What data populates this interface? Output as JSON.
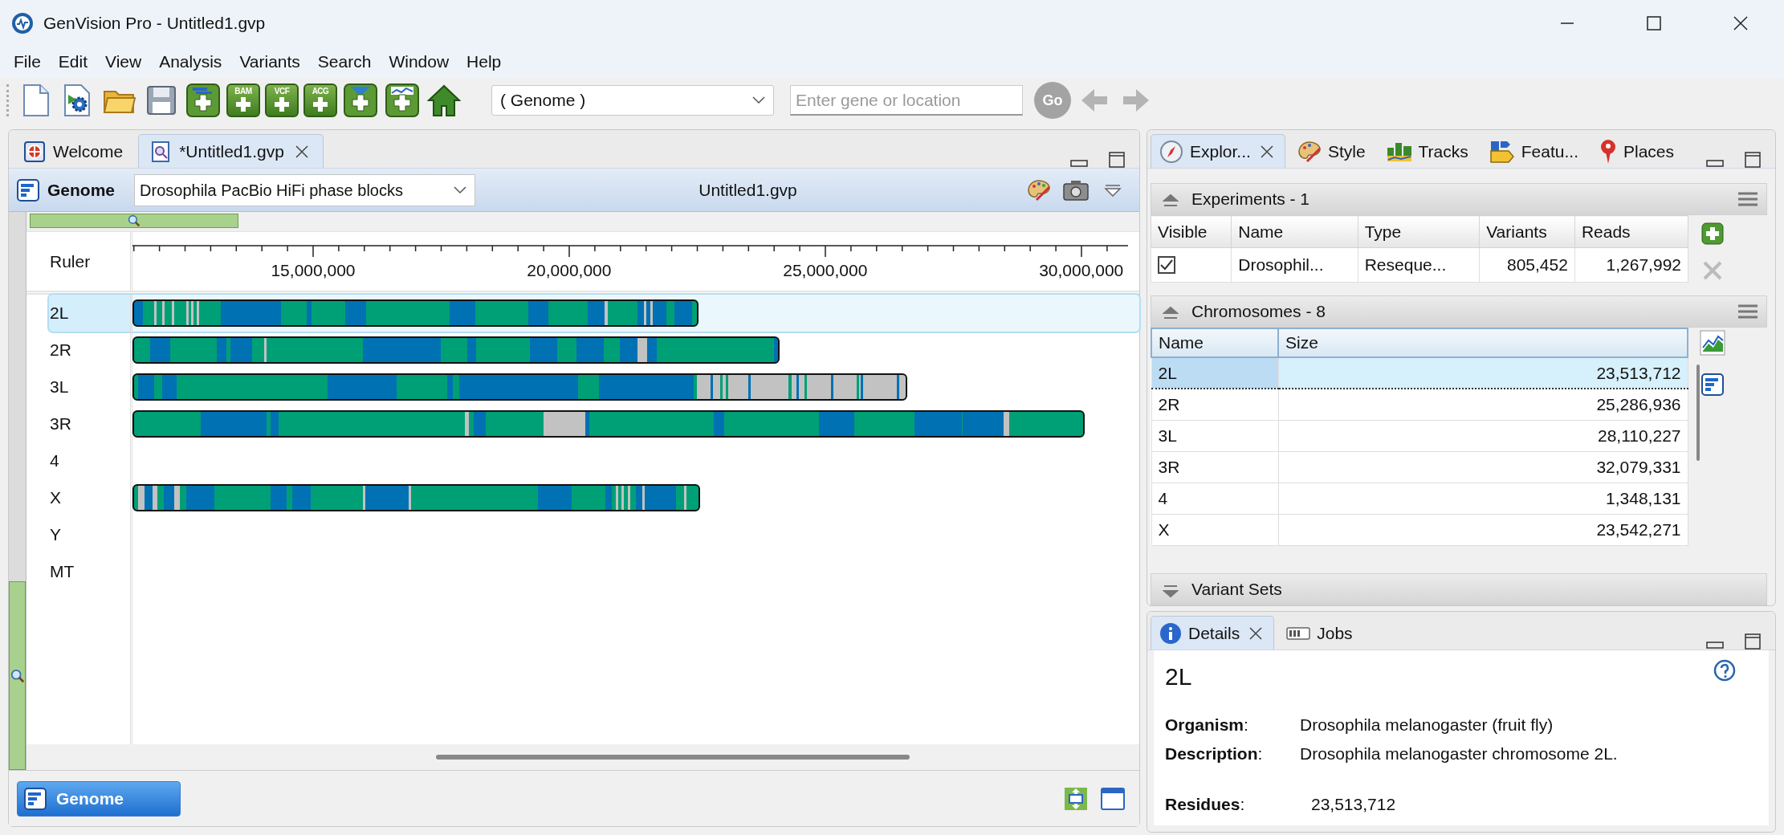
{
  "window": {
    "title": "GenVision Pro - Untitled1.gvp"
  },
  "menu": [
    "File",
    "Edit",
    "View",
    "Analysis",
    "Variants",
    "Search",
    "Window",
    "Help"
  ],
  "toolbar": [
    {
      "kind": "new-document"
    },
    {
      "kind": "document-settings"
    },
    {
      "kind": "folder"
    },
    {
      "kind": "save"
    },
    {
      "kind": "add-tracks"
    },
    {
      "kind": "add-labeled",
      "label": "BAM"
    },
    {
      "kind": "add-labeled",
      "label": "VCF"
    },
    {
      "kind": "add-labeled",
      "label": "ACG"
    },
    {
      "kind": "add-filter"
    },
    {
      "kind": "add-chart"
    },
    {
      "kind": "home"
    }
  ],
  "genome_select": {
    "value": "( Genome )"
  },
  "location_field": {
    "placeholder": "Enter gene or location"
  },
  "go_button": {
    "label": "Go",
    "disabled": true
  },
  "navigation": [
    {
      "kind": "back",
      "disabled": true
    },
    {
      "kind": "forward",
      "disabled": true
    }
  ],
  "editor_tabs": [
    {
      "kind": "welcome",
      "label": "Welcome",
      "selected": false,
      "closable": false
    },
    {
      "kind": "genome-document",
      "label": "*Untitled1.gvp",
      "selected": true,
      "closable": true
    }
  ],
  "genome_view": {
    "title": "Genome",
    "track_select": "Drosophila PacBio HiFi phase blocks",
    "file_label": "Untitled1.gvp",
    "ruler_label": "Ruler",
    "ruler_ticks": [
      "15,000,000",
      "20,000,000",
      "25,000,000",
      "30,000,000"
    ],
    "chromosomes": [
      {
        "name": "2L",
        "selected": true
      },
      {
        "name": "2R",
        "selected": false
      },
      {
        "name": "3L",
        "selected": false
      },
      {
        "name": "3R",
        "selected": false
      },
      {
        "name": "4",
        "selected": false
      },
      {
        "name": "X",
        "selected": false
      },
      {
        "name": "Y",
        "selected": false
      },
      {
        "name": "MT",
        "selected": false
      }
    ]
  },
  "view_switch": {
    "label": "Genome"
  },
  "side_tabs": [
    {
      "kind": "explorer",
      "label": "Explor...",
      "selected": true,
      "closable": true
    },
    {
      "kind": "style",
      "label": "Style",
      "selected": false,
      "closable": false
    },
    {
      "kind": "tracks",
      "label": "Tracks",
      "selected": false,
      "closable": false
    },
    {
      "kind": "features",
      "label": "Featu...",
      "selected": false,
      "closable": false
    },
    {
      "kind": "places",
      "label": "Places",
      "selected": false,
      "closable": false
    }
  ],
  "experiments": {
    "title": "Experiments - 1",
    "expanded": true,
    "columns": [
      "Visible",
      "Name",
      "Type",
      "Variants",
      "Reads"
    ],
    "rows": [
      {
        "visible": true,
        "name": "Drosophil...",
        "type": "Reseque...",
        "variants": "805,452",
        "reads": "1,267,992"
      }
    ]
  },
  "chromosomes": {
    "title": "Chromosomes - 8",
    "expanded": true,
    "columns": [
      "Name",
      "Size"
    ],
    "rows": [
      {
        "name": "2L",
        "size": "23,513,712",
        "selected": true
      },
      {
        "name": "2R",
        "size": "25,286,936",
        "selected": false
      },
      {
        "name": "3L",
        "size": "28,110,227",
        "selected": false
      },
      {
        "name": "3R",
        "size": "32,079,331",
        "selected": false
      },
      {
        "name": "4",
        "size": "1,348,131",
        "selected": false
      },
      {
        "name": "X",
        "size": "23,542,271",
        "selected": false
      }
    ]
  },
  "variant_sets": {
    "title": "Variant Sets",
    "expanded": false
  },
  "details_tabs": [
    {
      "kind": "info",
      "label": "Details",
      "selected": true,
      "closable": true
    },
    {
      "kind": "jobs",
      "label": "Jobs",
      "selected": false,
      "closable": false
    }
  ],
  "details": {
    "heading": "2L",
    "fields": [
      {
        "label": "**Organism**:",
        "value": "Drosophila melanogaster (fruit fly)"
      },
      {
        "label": "**Description**:",
        "value": "Drosophila melanogaster chromosome 2L."
      }
    ],
    "summary": {
      "label": "**Residues**:",
      "value": "23,513,712"
    }
  }
}
